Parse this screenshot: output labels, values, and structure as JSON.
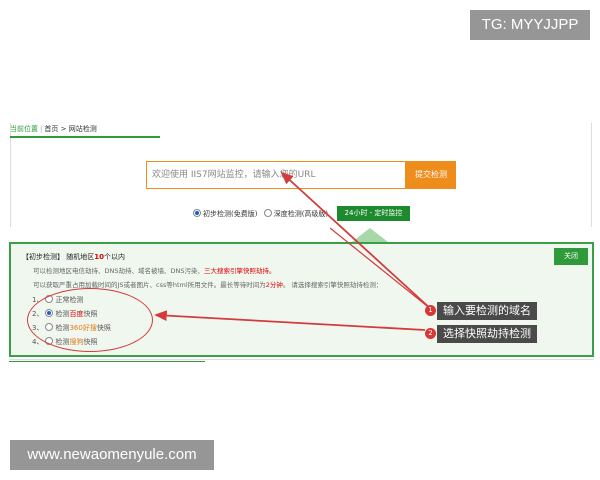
{
  "watermarks": {
    "top_right": "TG: MYYJJPP",
    "bottom_left": "www.newaomenyule.com"
  },
  "breadcrumb": {
    "current_label": "当前位置",
    "home": "首页",
    "separator": ">",
    "page": "网站检测"
  },
  "search": {
    "placeholder": "欢迎使用 IIS7网站监控，请输入您的URL",
    "submit_label": "提交检测"
  },
  "modes": [
    {
      "label": "初步检测(免费版)",
      "selected": true
    },
    {
      "label": "深度检测(高级版)",
      "selected": false
    }
  ],
  "monitor_button": "24小时 - 定时监控",
  "panel": {
    "close_label": "关闭",
    "title_prefix": "【初步检测】 随机地区",
    "title_count": "10",
    "title_suffix": "个以内",
    "line1_prefix": "可以检测地区电信劫持、DNS劫持、域名被墙、DNS污染、",
    "line1_highlight": "三大搜索引擎快照劫持。",
    "line2_prefix": "可以获取严重占用加载时间的JS或者图片、css等html所用文件。最长等待时间为",
    "line2_highlight": "2分钟",
    "line2_suffix": "。 请选择搜索引擎快照劫持检测：",
    "options": [
      {
        "num": "1、",
        "pre": "正常检测",
        "hl": "",
        "post": "",
        "selected": false
      },
      {
        "num": "2、",
        "pre": "检测",
        "hl": "百度",
        "post": "快照",
        "selected": true
      },
      {
        "num": "3、",
        "pre": "检测",
        "hl": "360好搜",
        "post": "快照",
        "selected": false
      },
      {
        "num": "4、",
        "pre": "检测",
        "hl": "搜狗",
        "post": "快照",
        "selected": false
      }
    ]
  },
  "callouts": [
    {
      "badge": "1",
      "text": "输入要检测的域名"
    },
    {
      "badge": "2",
      "text": "选择快照劫持检测"
    }
  ],
  "colors": {
    "accent_green": "#2e9a3a",
    "submit_orange": "#ef8d1c",
    "annotation_red": "#d23c3c"
  }
}
